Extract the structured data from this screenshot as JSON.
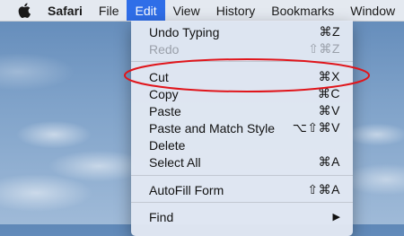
{
  "menubar": {
    "apple_icon": "apple-logo-icon",
    "items": [
      "Safari",
      "File",
      "Edit",
      "View",
      "History",
      "Bookmarks",
      "Window"
    ],
    "active": "Edit"
  },
  "edit_menu": {
    "items": [
      {
        "label": "Undo Typing",
        "shortcut": "⌘Z",
        "enabled": true
      },
      {
        "label": "Redo",
        "shortcut": "⇧⌘Z",
        "enabled": false
      },
      {
        "label": "Cut",
        "shortcut": "⌘X",
        "enabled": true
      },
      {
        "label": "Copy",
        "shortcut": "⌘C",
        "enabled": true
      },
      {
        "label": "Paste",
        "shortcut": "⌘V",
        "enabled": true
      },
      {
        "label": "Paste and Match Style",
        "shortcut": "⌥⇧⌘V",
        "enabled": true
      },
      {
        "label": "Delete",
        "shortcut": "",
        "enabled": true
      },
      {
        "label": "Select All",
        "shortcut": "⌘A",
        "enabled": true
      },
      {
        "label": "AutoFill Form",
        "shortcut": "⇧⌘A",
        "enabled": true
      },
      {
        "label": "Find",
        "shortcut": "",
        "enabled": true,
        "submenu_icon": "chevron-right-icon"
      }
    ]
  },
  "annotation": {
    "shape": "ellipse",
    "color": "#e0151b",
    "target": "Cut"
  },
  "colors": {
    "menu_highlight": "#2f6ee8",
    "menu_background": "#e2e8f3",
    "disabled_text": "#9aa0aa"
  }
}
